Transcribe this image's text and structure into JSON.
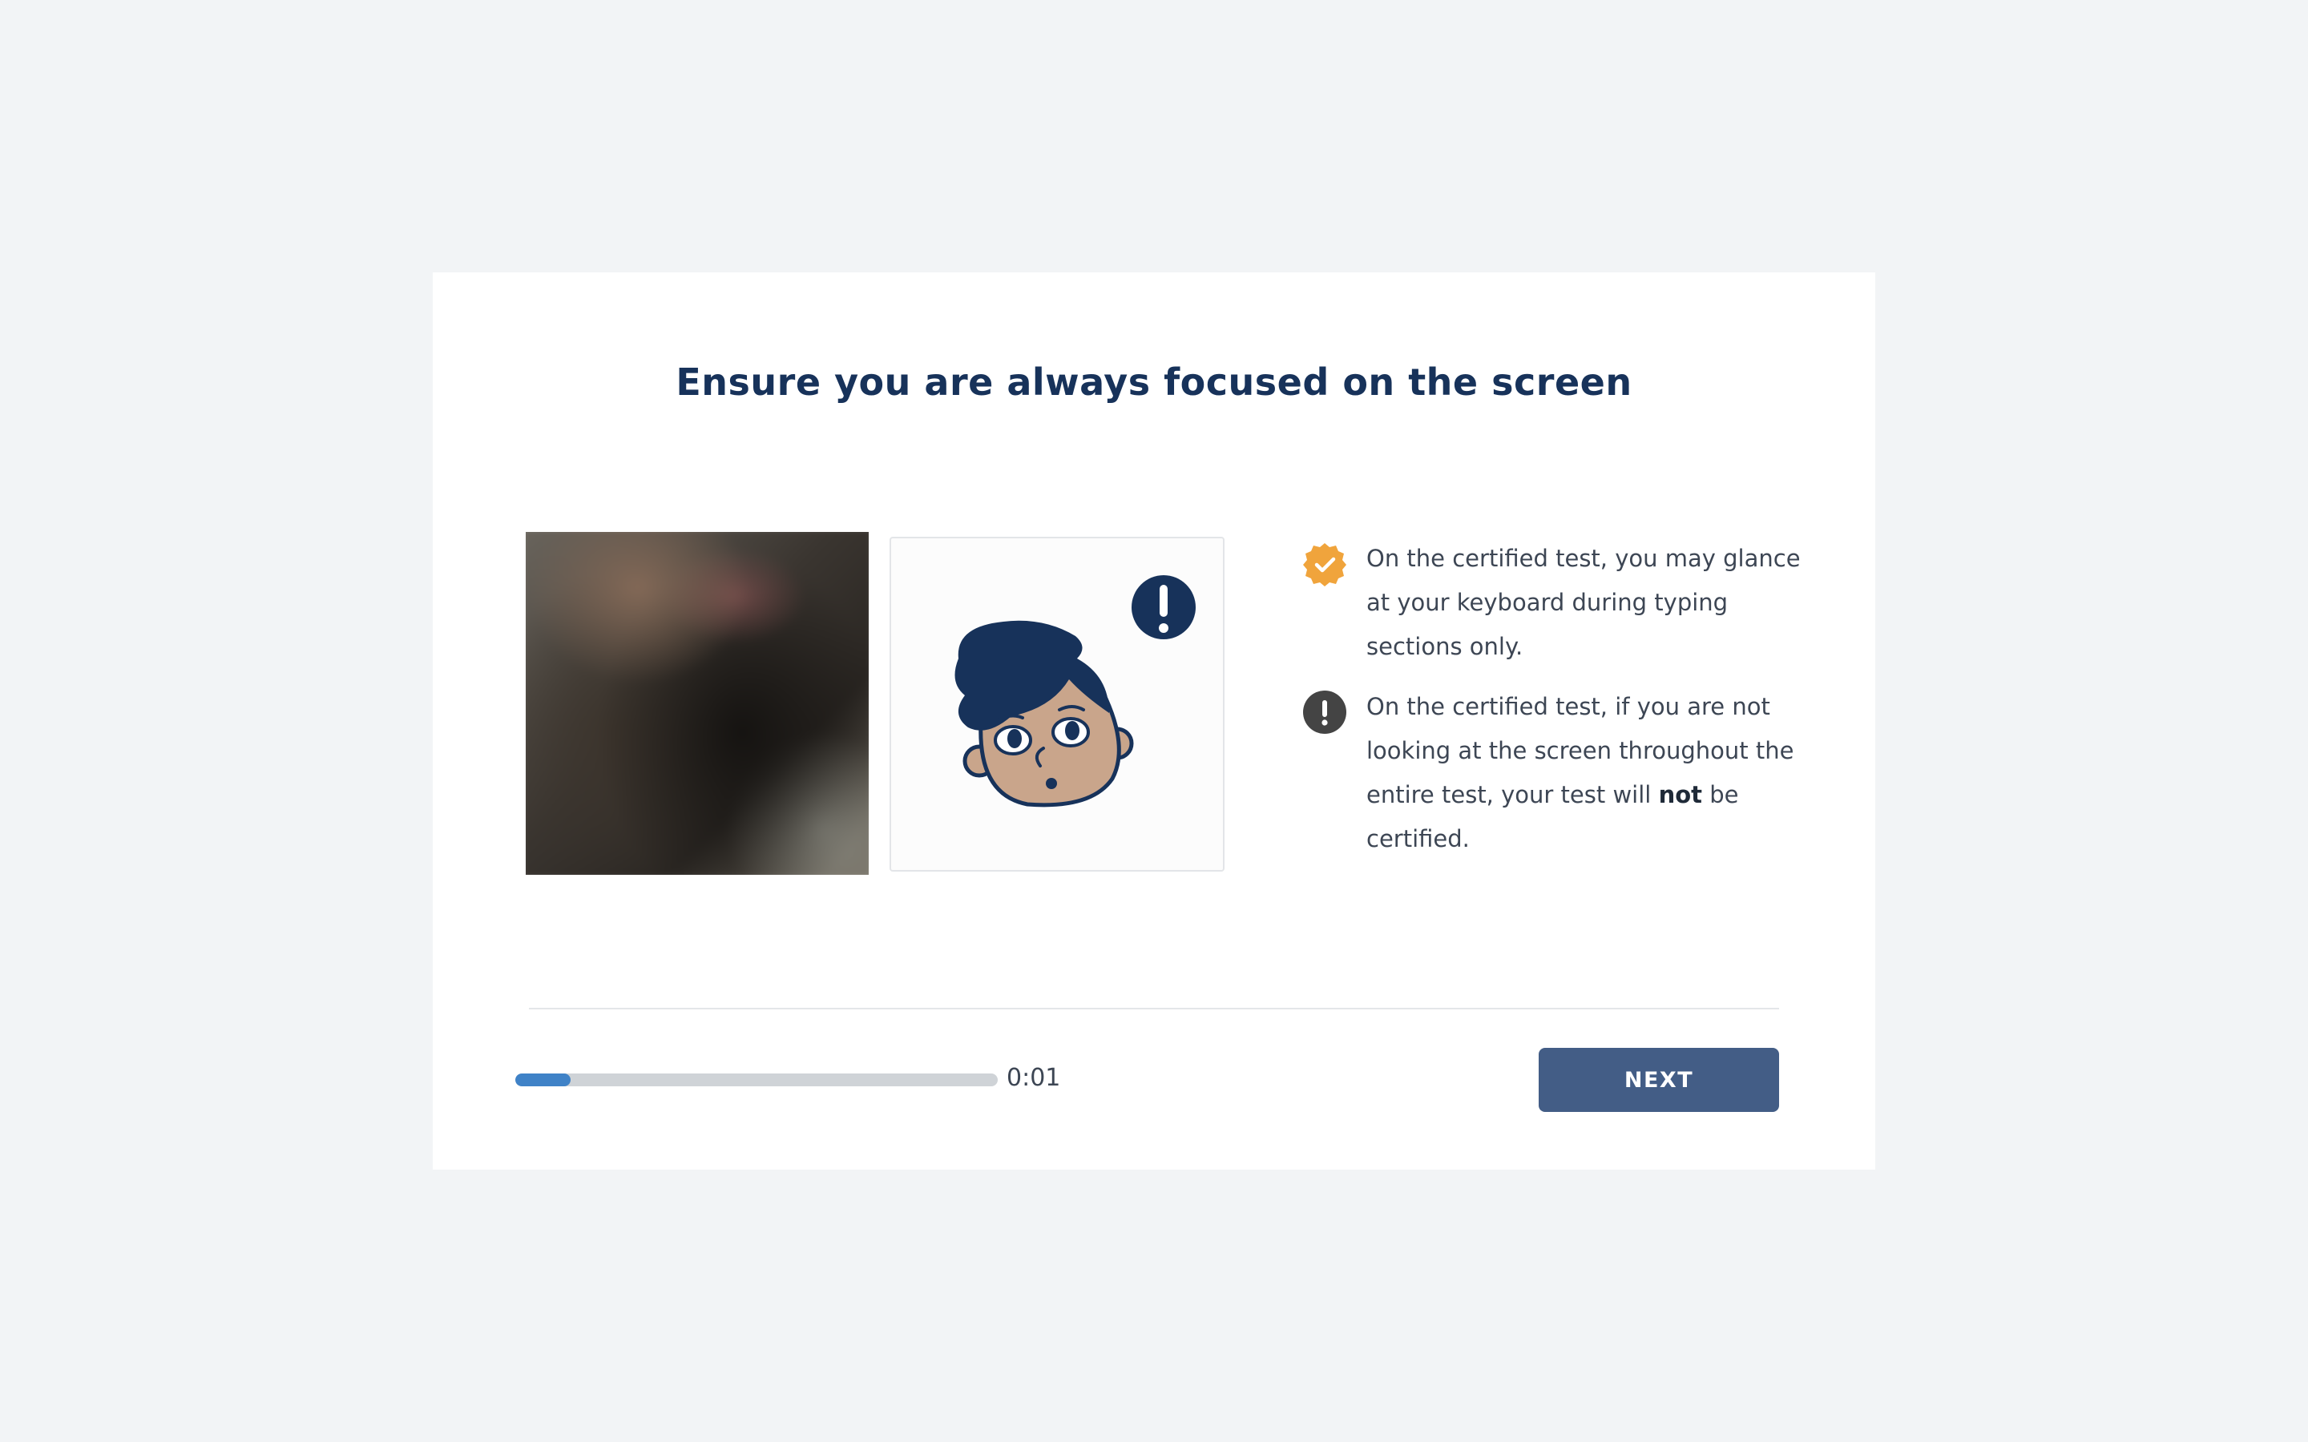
{
  "page": {
    "title": "Ensure you are always focused on the screen"
  },
  "webcam": {
    "icon": "webcam-preview"
  },
  "illustration": {
    "icon": "face-looking-away-alert",
    "colors": {
      "hair": "#17325a",
      "skin": "#c9a58b",
      "alert": "#17325a"
    }
  },
  "notes": [
    {
      "icon": "check-badge-icon",
      "icon_color": "#f0a43c",
      "text": "On the certified test, you may glance at your keyboard during typing sections only."
    },
    {
      "icon": "exclamation-circle-icon",
      "icon_color": "#444444",
      "text_before": "On the certified test, if you are not looking at the screen throughout the entire test, your test will ",
      "text_bold": "not",
      "text_after": " be certified."
    }
  ],
  "footer": {
    "progress": 0.115,
    "progress_color": "#3f82c7",
    "timer": "0:01",
    "next_label": "NEXT",
    "next_color": "#435d86"
  }
}
